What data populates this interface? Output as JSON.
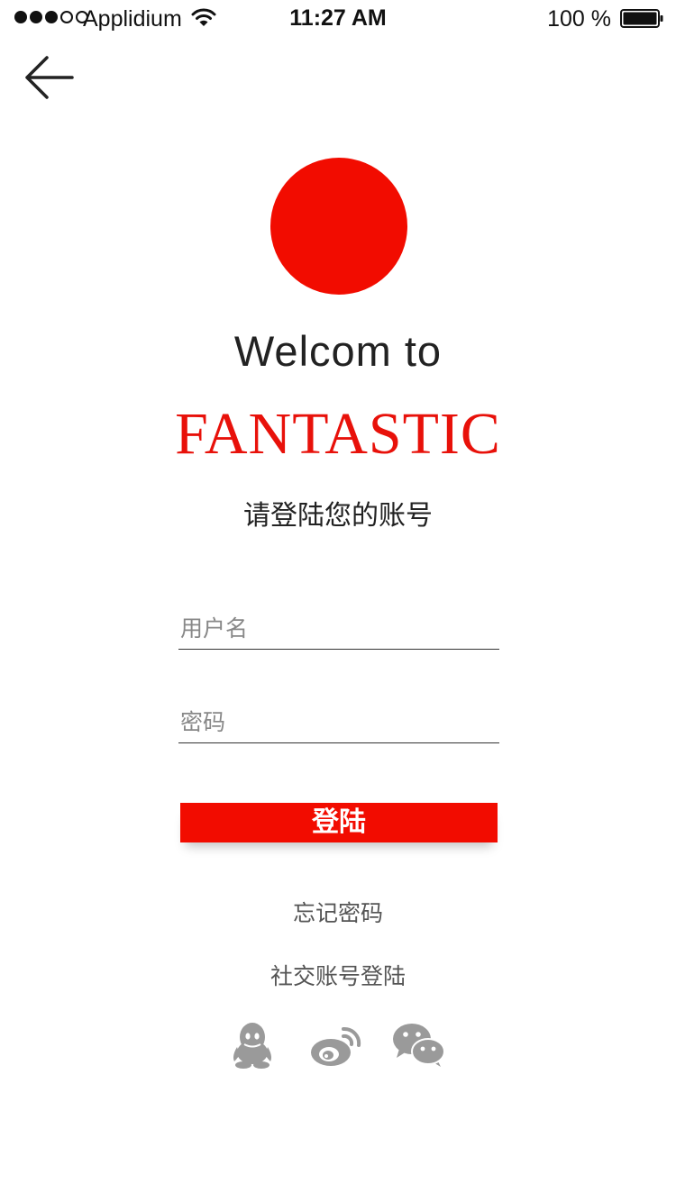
{
  "status_bar": {
    "carrier": "Applidium",
    "time": "11:27 AM",
    "battery_text": "100 %",
    "signal_bars_filled": 3,
    "signal_bars_total": 5
  },
  "icons": {
    "back": "back-arrow-icon",
    "qq": "qq-icon",
    "weibo": "weibo-icon",
    "wechat": "wechat-icon"
  },
  "colors": {
    "accent": "#f20c00",
    "icon_gray": "#999999"
  },
  "header": {
    "welcome": "Welcom to",
    "brand": "FANTASTIC",
    "subtitle": "请登陆您的账号"
  },
  "form": {
    "username_placeholder": "用户名",
    "password_placeholder": "密码",
    "login_label": "登陆"
  },
  "links": {
    "forgot_password": "忘记密码",
    "social_login": "社交账号登陆"
  }
}
